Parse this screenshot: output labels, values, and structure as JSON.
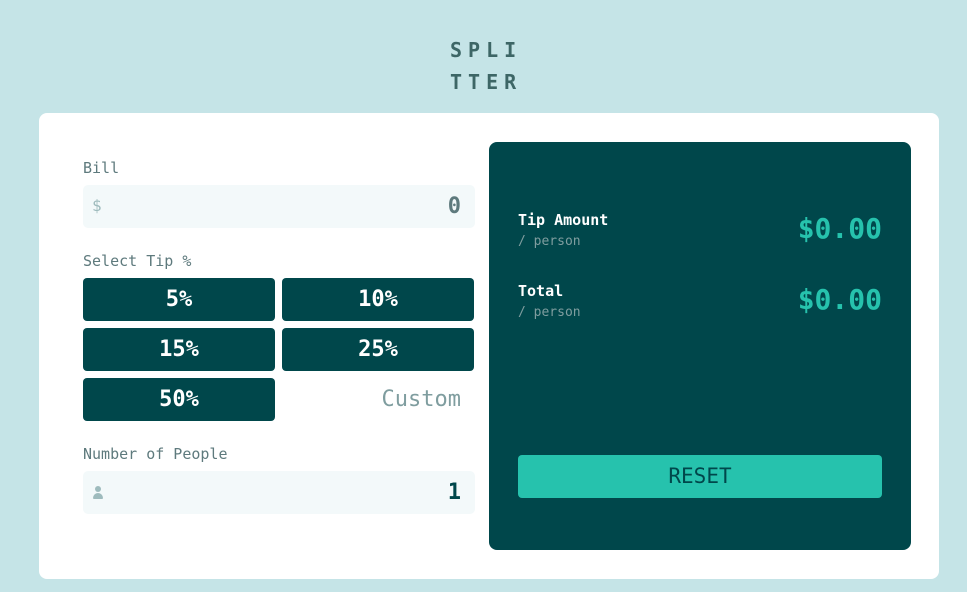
{
  "logo": {
    "line1": "SPLI",
    "line2": "TTER"
  },
  "bill": {
    "label": "Bill",
    "currency_symbol": "$",
    "value": "0"
  },
  "tip": {
    "label": "Select Tip %",
    "options": [
      "5%",
      "10%",
      "15%",
      "25%",
      "50%"
    ],
    "custom_placeholder": "Custom"
  },
  "people": {
    "label": "Number of People",
    "icon": "person-icon",
    "value": "1"
  },
  "results": {
    "tip_amount": {
      "title": "Tip Amount",
      "subtitle": "/ person",
      "value": "$0.00"
    },
    "total": {
      "title": "Total",
      "subtitle": "/ person",
      "value": "$0.00"
    },
    "reset_label": "RESET"
  },
  "colors": {
    "background": "#c5e4e7",
    "dark_cyan": "#00474b",
    "strong_cyan": "#26c2ad",
    "input_bg": "#f3f9fa"
  }
}
